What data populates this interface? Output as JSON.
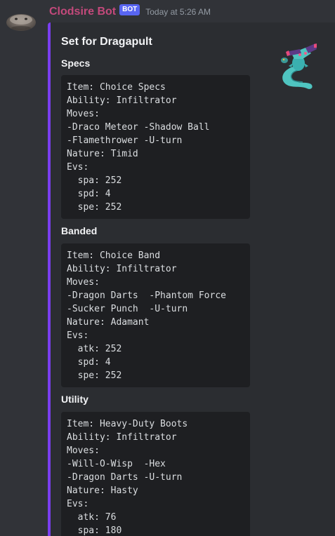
{
  "message": {
    "username": "Clodsire Bot",
    "badge": "BOT",
    "timestamp": "Today at 5:26 AM",
    "avatar_icon": "clodsire-avatar-icon"
  },
  "embed": {
    "accent_color": "#7a3ef0",
    "title": "Set for Dragapult",
    "thumbnail_icon": "dragapult-sprite-icon",
    "fields": [
      {
        "name": "Specs",
        "lines": [
          "Item: Choice Specs",
          "Ability: Infiltrator",
          "Moves:",
          "-Draco Meteor -Shadow Ball",
          "-Flamethrower -U-turn",
          "Nature: Timid",
          "Evs:",
          "  spa: 252",
          "  spd: 4",
          "  spe: 252"
        ]
      },
      {
        "name": "Banded",
        "lines": [
          "Item: Choice Band",
          "Ability: Infiltrator",
          "Moves:",
          "-Dragon Darts  -Phantom Force",
          "-Sucker Punch  -U-turn",
          "Nature: Adamant",
          "Evs:",
          "  atk: 252",
          "  spd: 4",
          "  spe: 252"
        ]
      },
      {
        "name": "Utility",
        "lines": [
          "Item: Heavy-Duty Boots",
          "Ability: Infiltrator",
          "Moves:",
          "-Will-O-Wisp  -Hex",
          "-Dragon Darts -U-turn",
          "Nature: Hasty",
          "Evs:",
          "  atk: 76",
          "  spa: 180"
        ]
      }
    ]
  },
  "colors": {
    "background": "#313338",
    "embed_background": "#2b2d31",
    "code_background": "#1e1f22",
    "username": "#c3497b",
    "badge": "#5865f2"
  }
}
